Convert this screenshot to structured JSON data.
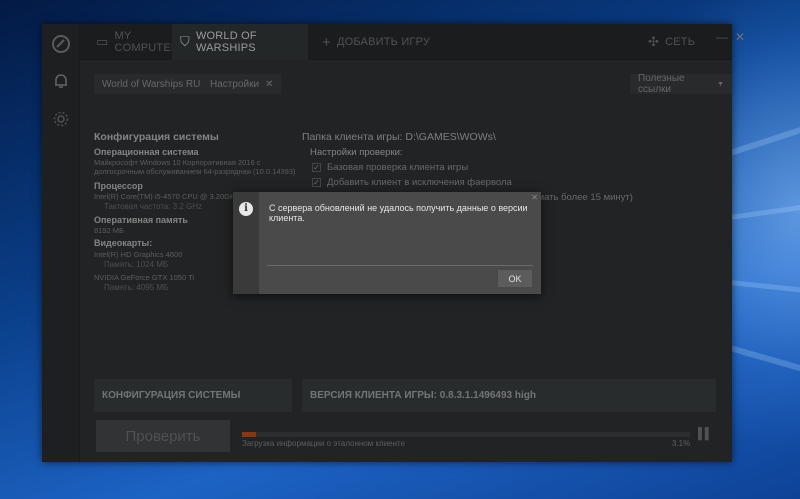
{
  "tabs": {
    "my_computer": "MY COMPUTER",
    "game": "WORLD OF WARSHIPS",
    "add_game": "ДОБАВИТЬ ИГРУ",
    "network": "СЕТЬ"
  },
  "toolbar": {
    "game_select": "World of Warships RU",
    "settings": "Настройки",
    "useful_links": "Полезные ссылки"
  },
  "system": {
    "title": "Конфигурация системы",
    "os_label": "Операционная система",
    "os_value_line1": "Майкрософт Windows 10 Корпоративная 2016 с",
    "os_value_line2": "долгосрочным обслуживанием 64-разрядная  (10.0.14393)",
    "cpu_label": "Процессор",
    "cpu_value": "Intel(R) Core(TM) i5-4570 CPU @ 3.20GHz (4 CPUs)",
    "cpu_freq": "Тактовая частота: 3.2 GHz",
    "ram_label": "Оперативная память",
    "ram_value": "8192 МБ",
    "gpu_label": "Видеокарты:",
    "gpu1_name": "Intel(R) HD Graphics 4600",
    "gpu1_mem": "Память: 1024 МБ",
    "gpu2_name": "NVIDIA GeForce GTX 1050 Ti",
    "gpu2_mem": "Память: 4095 МБ"
  },
  "client": {
    "folder": "Папка клиента игры:  D:\\GAMES\\WOWs\\",
    "check_settings": "Настройки проверки:",
    "opt1": "Базовая проверка клиента игры",
    "opt2": "Добавить клиент в исключения фаервола",
    "opt3": "Расширенная сетевая диагностика (может занимать более 15 минут)"
  },
  "bottom": {
    "config_tab": "КОНФИГУРАЦИЯ СИСТЕМЫ",
    "version": "ВЕРСИЯ КЛИЕНТА ИГРЫ: 0.8.3.1.1496493 high",
    "verify_button": "Проверить",
    "progress_text": "Загрузка информации о эталонном клиенте",
    "progress_pct": "3.1%",
    "progress_value": 0.031
  },
  "dialog": {
    "message": "С сервера обновлений не удалось получить данные о версии клиента.",
    "ok": "OK"
  },
  "colors": {
    "progress": "#b84e1c",
    "window_bg": "#2e3133"
  }
}
